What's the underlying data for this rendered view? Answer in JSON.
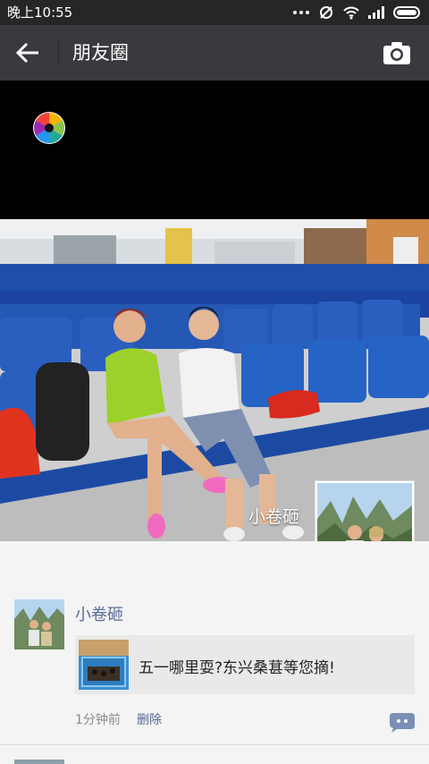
{
  "status_bar": {
    "time": "晚上10:55",
    "icons": [
      "more-dots-icon",
      "mute-icon",
      "wifi-icon",
      "signal-icon",
      "battery-icon"
    ]
  },
  "header": {
    "title": "朋友圈",
    "back_icon": "back-arrow-icon",
    "camera_icon": "camera-icon"
  },
  "cover": {
    "owner_name": "小卷砸"
  },
  "posts": [
    {
      "author": "小卷砸",
      "share_title": "五一哪里耍?东兴桑葚等您摘!",
      "time": "1分钟前",
      "delete_label": "删除",
      "comment_icon": "comment-icon"
    }
  ],
  "colors": {
    "status_bar": "#262626",
    "title_bar": "#393a3f",
    "link_blue": "#576b95",
    "share_card_bg": "#e9e9e9"
  }
}
